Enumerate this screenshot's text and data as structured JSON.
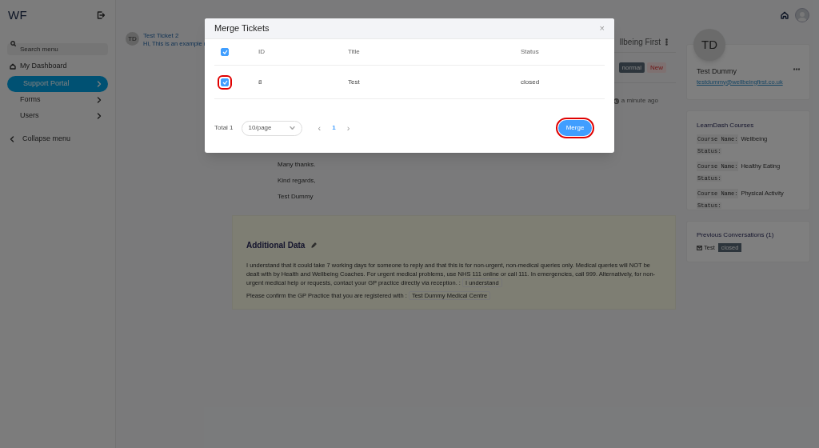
{
  "sidebar": {
    "logo": "WF",
    "search": {
      "placeholder": "Search menu"
    },
    "items": [
      {
        "label": "My Dashboard",
        "kind": "home",
        "selected": false
      },
      {
        "label": "Support Portal",
        "kind": "sub",
        "selected": true
      },
      {
        "label": "Forms",
        "kind": "sub",
        "selected": false
      },
      {
        "label": "Users",
        "kind": "sub",
        "selected": false
      }
    ],
    "collapse": "Collapse menu"
  },
  "conversations": [
    {
      "avatar": "TD",
      "title": "Test Ticket 2",
      "preview": "Hi,  This is an example r"
    }
  ],
  "ticket": {
    "title": "llbeing First",
    "tags": [
      {
        "label": "normal",
        "kind": "priority"
      },
      {
        "label": "New",
        "kind": "status"
      }
    ],
    "time": "a minute ago",
    "body": [
      "Many thanks.",
      "Kind regards,",
      "Test Dummy"
    ],
    "additional_data": {
      "title": "Additional Data",
      "answers": [
        {
          "text": "I understand that it could take 7 working days for someone to reply and that this is for non-urgent, non-medical queries only. Medical queries will NOT be dealt with by Health and Wellbeing Coaches. For urgent medical problems, use NHS 111 online or call 111. In emergencies, call 999. Alternatively, for non-urgent medical help or requests, contact your GP practice directly via reception. :",
          "value": "I understand"
        },
        {
          "text": "Please confirm the GP Practice that you are registered with :",
          "value": "Test Dummy Medical Centre"
        }
      ]
    }
  },
  "contact": {
    "avatar": "TD",
    "name": "Test Dummy",
    "email": "testdummy@wellbeingfirst.co.uk"
  },
  "courses": {
    "title": "LearnDash Courses",
    "items": [
      {
        "label": "Course Name:",
        "name": "Wellbeing",
        "status": "Status:"
      },
      {
        "label": "Course Name:",
        "name": "Healthy Eating",
        "status": "Status:"
      },
      {
        "label": "Course Name:",
        "name": "Physical Activity",
        "status": "Status:"
      }
    ]
  },
  "previous": {
    "title": "Previous Conversations (1)",
    "items": [
      {
        "title": "Test",
        "status": "closed"
      }
    ]
  },
  "modal": {
    "title": "Merge Tickets",
    "close": "×",
    "header_checked": true,
    "columns": [
      "ID",
      "Title",
      "Status"
    ],
    "rows": [
      {
        "checked": true,
        "highlighted": true,
        "cells": [
          "8",
          "Test",
          "closed"
        ]
      }
    ],
    "total": "Total 1",
    "prev": "‹",
    "next": "›",
    "page_size": "10/page",
    "pages": [
      {
        "label": "1",
        "selected": true
      }
    ],
    "merge": {
      "label": "Merge",
      "highlighted": true
    }
  }
}
